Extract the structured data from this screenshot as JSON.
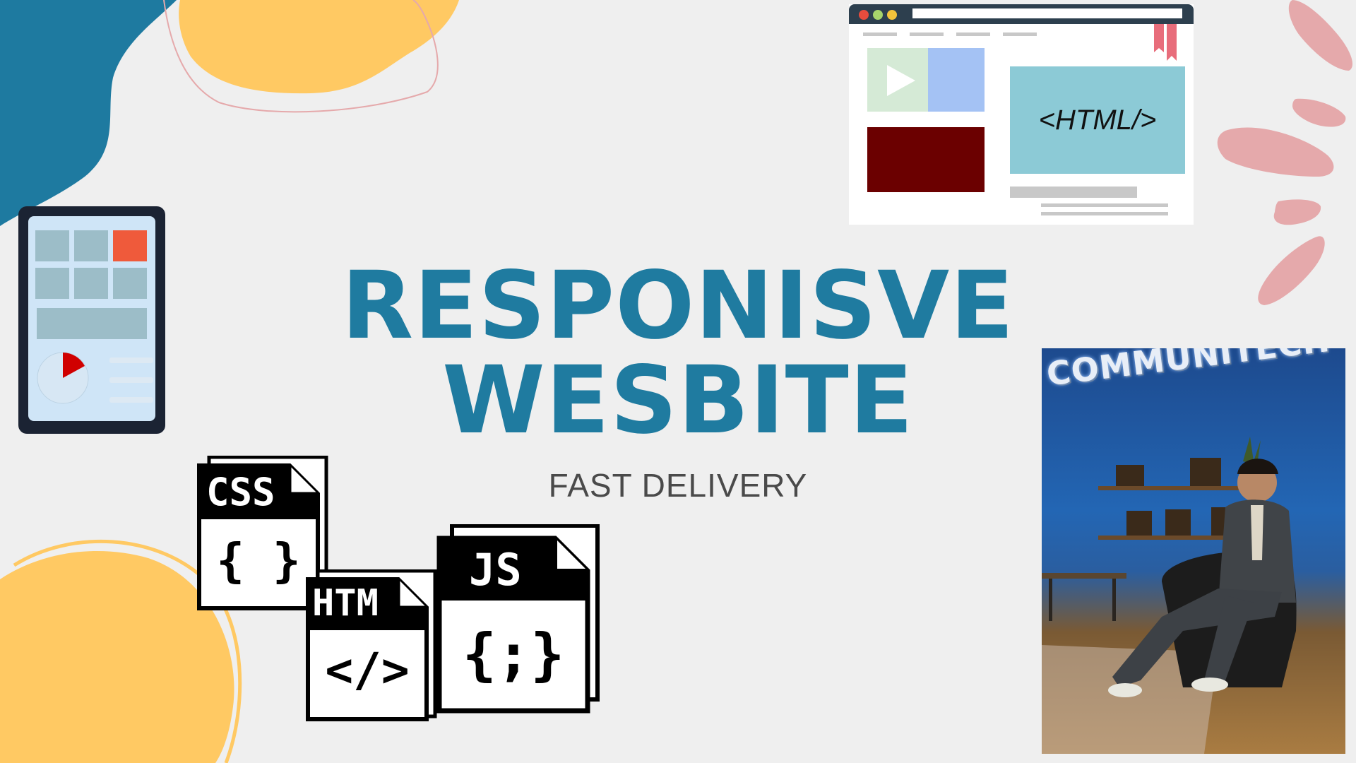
{
  "title": {
    "line1": "RESPONISVE",
    "line2": "WESBITE",
    "subtitle": "FAST DELIVERY"
  },
  "browser_mockup": {
    "code_label": "<HTML/>"
  },
  "file_icons": [
    {
      "label": "CSS",
      "glyph": "{ }"
    },
    {
      "label": "HTM",
      "glyph": "</>"
    },
    {
      "label": "JS",
      "glyph": "{;}"
    }
  ],
  "photo": {
    "sign_text": "COMMUNITECH"
  },
  "colors": {
    "background": "#efefef",
    "title": "#1f7ba0",
    "subtitle": "#4a4a4a",
    "blob_teal": "#1e7aa0",
    "blob_yellow": "#ffc963",
    "petals_pink": "#e5a9ab",
    "tablet_accent": "#ef5a3b",
    "browser_block_dark": "#6b0000",
    "browser_block_blue": "#a4c2f4",
    "browser_block_green": "#d5ead6"
  }
}
